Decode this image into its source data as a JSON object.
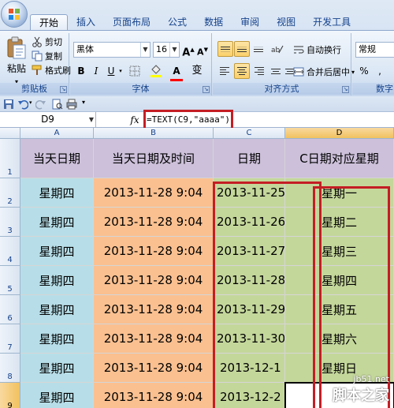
{
  "ribbon": {
    "tabs": [
      "开始",
      "插入",
      "页面布局",
      "公式",
      "数据",
      "审阅",
      "视图",
      "开发工具"
    ],
    "active_tab": "开始",
    "clipboard": {
      "paste": "粘贴",
      "cut": "剪切",
      "copy": "复制",
      "format_painter": "格式刷",
      "label": "剪贴板"
    },
    "font": {
      "family": "黑体",
      "size": "16",
      "grow": "A",
      "shrink": "A",
      "bold": "B",
      "italic": "I",
      "underline": "U",
      "phonetic": "变",
      "label": "字体"
    },
    "alignment": {
      "wrap_text": "自动换行",
      "merge_center": "合并后居中",
      "label": "对齐方式"
    },
    "number": {
      "format": "常规",
      "label": "数字"
    }
  },
  "formula_bar": {
    "name_box": "D9",
    "fx": "fx",
    "formula": "=TEXT(C9,\"aaaa\")"
  },
  "sheet": {
    "columns": [
      "A",
      "B",
      "C",
      "D"
    ],
    "header_row": [
      "当天日期",
      "当天日期及时间",
      "日期",
      "C日期对应星期"
    ],
    "row_numbers": [
      "1",
      "2",
      "3",
      "4",
      "5",
      "6",
      "7",
      "8",
      "9"
    ],
    "rows": [
      [
        "星期四",
        "2013-11-28  9:04",
        "2013-11-25",
        "星期一"
      ],
      [
        "星期四",
        "2013-11-28  9:04",
        "2013-11-26",
        "星期二"
      ],
      [
        "星期四",
        "2013-11-28  9:04",
        "2013-11-27",
        "星期三"
      ],
      [
        "星期四",
        "2013-11-28  9:04",
        "2013-11-28",
        "星期四"
      ],
      [
        "星期四",
        "2013-11-28  9:04",
        "2013-11-29",
        "星期五"
      ],
      [
        "星期四",
        "2013-11-28  9:04",
        "2013-11-30",
        "星期六"
      ],
      [
        "星期四",
        "2013-11-28  9:04",
        "2013-12-1",
        "星期日"
      ],
      [
        "星期四",
        "2013-11-28  9:04",
        "2013-12-2",
        ""
      ]
    ],
    "colors": {
      "header_fill": "#ccc0da",
      "col_a_fill": "#b7dee8",
      "col_b_fill": "#fac090",
      "col_c_fill": "#c4d79b",
      "highlight": "#c41e24"
    }
  },
  "watermark": {
    "site": "jb51.net",
    "brand": "脚本之家"
  }
}
